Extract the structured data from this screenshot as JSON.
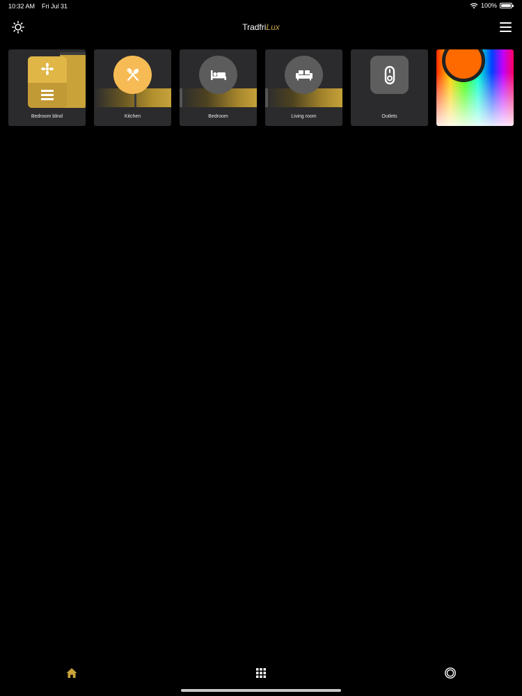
{
  "status_bar": {
    "time": "10:32 AM",
    "date": "Fri Jul 31",
    "battery": "100%"
  },
  "header": {
    "title_main": "Tradfri",
    "title_accent": "Lux"
  },
  "tiles": [
    {
      "label": "Bedroom blind",
      "icon": "blind-icon"
    },
    {
      "label": "Kitchen",
      "icon": "utensils-icon"
    },
    {
      "label": "Bedroom",
      "icon": "bed-icon"
    },
    {
      "label": "Living room",
      "icon": "sofa-icon"
    },
    {
      "label": "Outlets",
      "icon": "outlet-icon"
    }
  ],
  "colors": {
    "accent": "#c9a23a",
    "background": "#000000",
    "tile": "#2b2b2d",
    "knob": "#ff6a00"
  },
  "tabbar": {
    "items": [
      "home-icon",
      "grid-icon",
      "circle-icon"
    ]
  }
}
